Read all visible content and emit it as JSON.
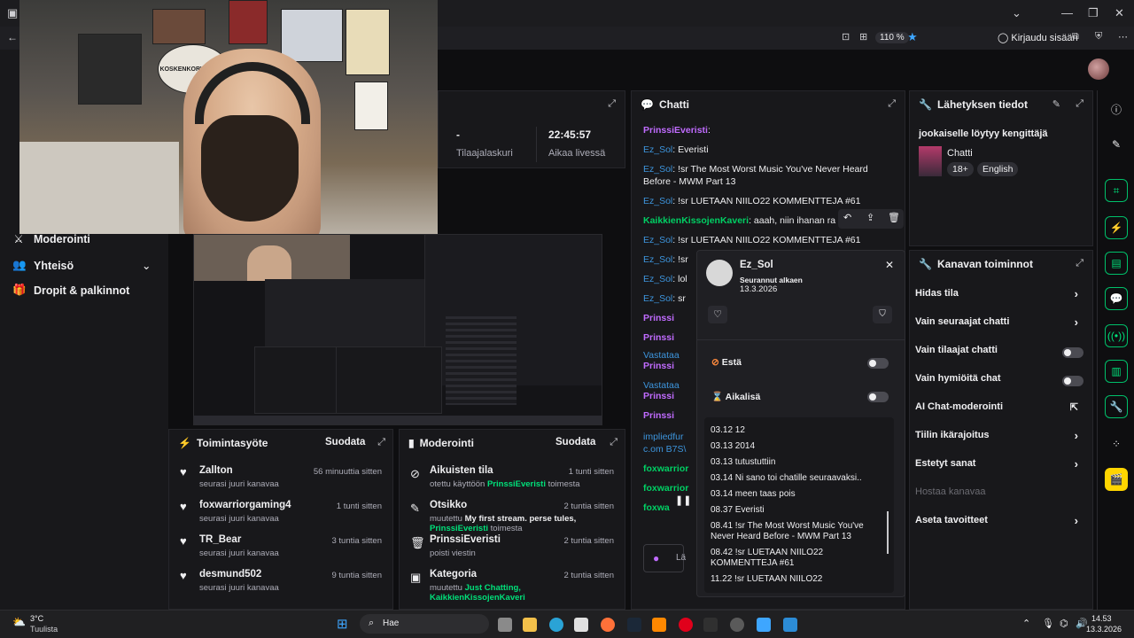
{
  "browser": {
    "zoom": "110 %",
    "login": "Kirjaudu sisään"
  },
  "leftnav": {
    "items": [
      {
        "label": "Moderointi",
        "icon": "sword-icon"
      },
      {
        "label": "Yhteisö",
        "icon": "people-icon"
      },
      {
        "label": "Dropit & palkinnot",
        "icon": "gift-icon"
      }
    ]
  },
  "webcam": {
    "poster_text": "KOSKENKORVA VIINA"
  },
  "stats": {
    "subs_value": "-",
    "subs_label": "Tilaajalaskuri",
    "uptime_value": "22:45:57",
    "uptime_label": "Aikaa livessä"
  },
  "activity": {
    "title": "Toimintasyöte",
    "filter": "Suodata",
    "rows": [
      {
        "name": "Zallton",
        "sub": "seurasi juuri kanavaa",
        "time": "56 minuuttia sitten"
      },
      {
        "name": "foxwarriorgaming4",
        "sub": "seurasi juuri kanavaa",
        "time": "1 tunti sitten"
      },
      {
        "name": "TR_Bear",
        "sub": "seurasi juuri kanavaa",
        "time": "3 tuntia sitten"
      },
      {
        "name": "desmund502",
        "sub": "seurasi juuri kanavaa",
        "time": "9 tuntia sitten"
      }
    ]
  },
  "moderation": {
    "title": "Moderointi",
    "filter": "Suodata",
    "rows": [
      {
        "title": "Aikuisten tila",
        "sub_prefix": "otettu käyttöön",
        "sub_user": "PrinssiEveristi",
        "sub_suffix": "toimesta",
        "time": "1 tunti sitten"
      },
      {
        "title": "Otsikko",
        "sub_prefix": "muutettu",
        "sub_bold": "My first stream. perse tules,",
        "sub_user": "PrinssiEveristi",
        "sub_suffix": "toimesta",
        "time": "2 tuntia sitten"
      },
      {
        "title": "PrinssiEveristi",
        "sub_prefix": "poisti viestin",
        "time": "2 tuntia sitten"
      },
      {
        "title": "Kategoria",
        "sub_prefix": "muutettu",
        "sub_user": "Just Chatting,",
        "sub_user2": "KaikkienKissojenKaveri",
        "time": "2 tuntia sitten"
      }
    ]
  },
  "chat": {
    "title": "Chatti",
    "lines": [
      {
        "user": "PrinssiEveristi",
        "text": ":"
      },
      {
        "user": "Ez_Sol",
        "text": ": Everisti"
      },
      {
        "user": "Ez_Sol",
        "text": ": !sr The Most Worst Music You've Never Heard Before - MWM Part 13"
      },
      {
        "user": "Ez_Sol",
        "text": ": !sr LUETAAN NIILO22 KOMMENTTEJA #61"
      },
      {
        "user": "KaikkienKissojenKaveri",
        "text": ": aaah, niin ihanan ra"
      },
      {
        "user": "Ez_Sol",
        "text": ": !sr LUETAAN NIILO22 KOMMENTTEJA #61"
      },
      {
        "user": "Ez_Sol",
        "text": ": !sr"
      },
      {
        "user": "Ez_Sol",
        "text": ": lol"
      },
      {
        "user": "Ez_Sol",
        "text": ": sr"
      },
      {
        "user": "Prinssi",
        "text": ""
      },
      {
        "user": "Prinssi",
        "text": ""
      },
      {
        "user": "Vastataa",
        "text": ""
      },
      {
        "user": "Prinssi",
        "text": ""
      },
      {
        "user": "Vastataa",
        "text": ""
      },
      {
        "user": "Prinssi",
        "text": ""
      },
      {
        "user": "Prinssi",
        "text": ""
      },
      {
        "user": "impliedfur",
        "text": ""
      },
      {
        "user": "c.om B7S\\",
        "text": ""
      },
      {
        "user": "foxwarrior",
        "text": ""
      },
      {
        "user": "foxwarrior",
        "text": ""
      },
      {
        "user": "foxwa",
        "text": ""
      }
    ],
    "input_placeholder": "Lä"
  },
  "usercard": {
    "name": "Ez_Sol",
    "follow_label": "Seurannut alkaen",
    "follow_date": "13.3.2026",
    "ban_label": "Estä",
    "timeout_label": "Aikalisä",
    "history": [
      "03.12 12",
      "03.13 2014",
      "03.13 tutustuttiin",
      "03.14 Ni sano toi chatille seuraavaksi..",
      "03.14 meen taas pois",
      "08.37 Everisti",
      "08.41 !sr The Most Worst Music You've Never Heard Before - MWM Part 13",
      "08.42 !sr LUETAAN NIILO22 KOMMENTTEJA #61",
      "11.22 !sr LUETAAN NIILO22"
    ]
  },
  "info": {
    "title": "Lähetyksen tiedot",
    "stream_title": "jookaiselle löytyy kengittäjä",
    "category": "Chatti",
    "tags": [
      "18+",
      "English"
    ]
  },
  "controls": {
    "title": "Kanavan toiminnot",
    "rows": [
      {
        "label": "Hidas tila",
        "kind": "arrow"
      },
      {
        "label": "Vain seuraajat chatti",
        "kind": "arrow"
      },
      {
        "label": "Vain tilaajat chatti",
        "kind": "toggle"
      },
      {
        "label": "Vain hymiöitä chat",
        "kind": "toggle"
      },
      {
        "label": "AI Chat-moderointi",
        "kind": "external"
      },
      {
        "label": "Tiilin ikärajoitus",
        "kind": "arrow"
      },
      {
        "label": "Estetyt sanat",
        "kind": "arrow"
      },
      {
        "label": "Hostaa kanavaa",
        "kind": "disabled"
      },
      {
        "label": "Aseta tavoitteet",
        "kind": "arrow"
      }
    ]
  },
  "taskbar": {
    "weather_temp": "3°C",
    "weather_text": "Tuulista",
    "search": "Hae",
    "time": "14.53",
    "date": "13.3.2026"
  }
}
